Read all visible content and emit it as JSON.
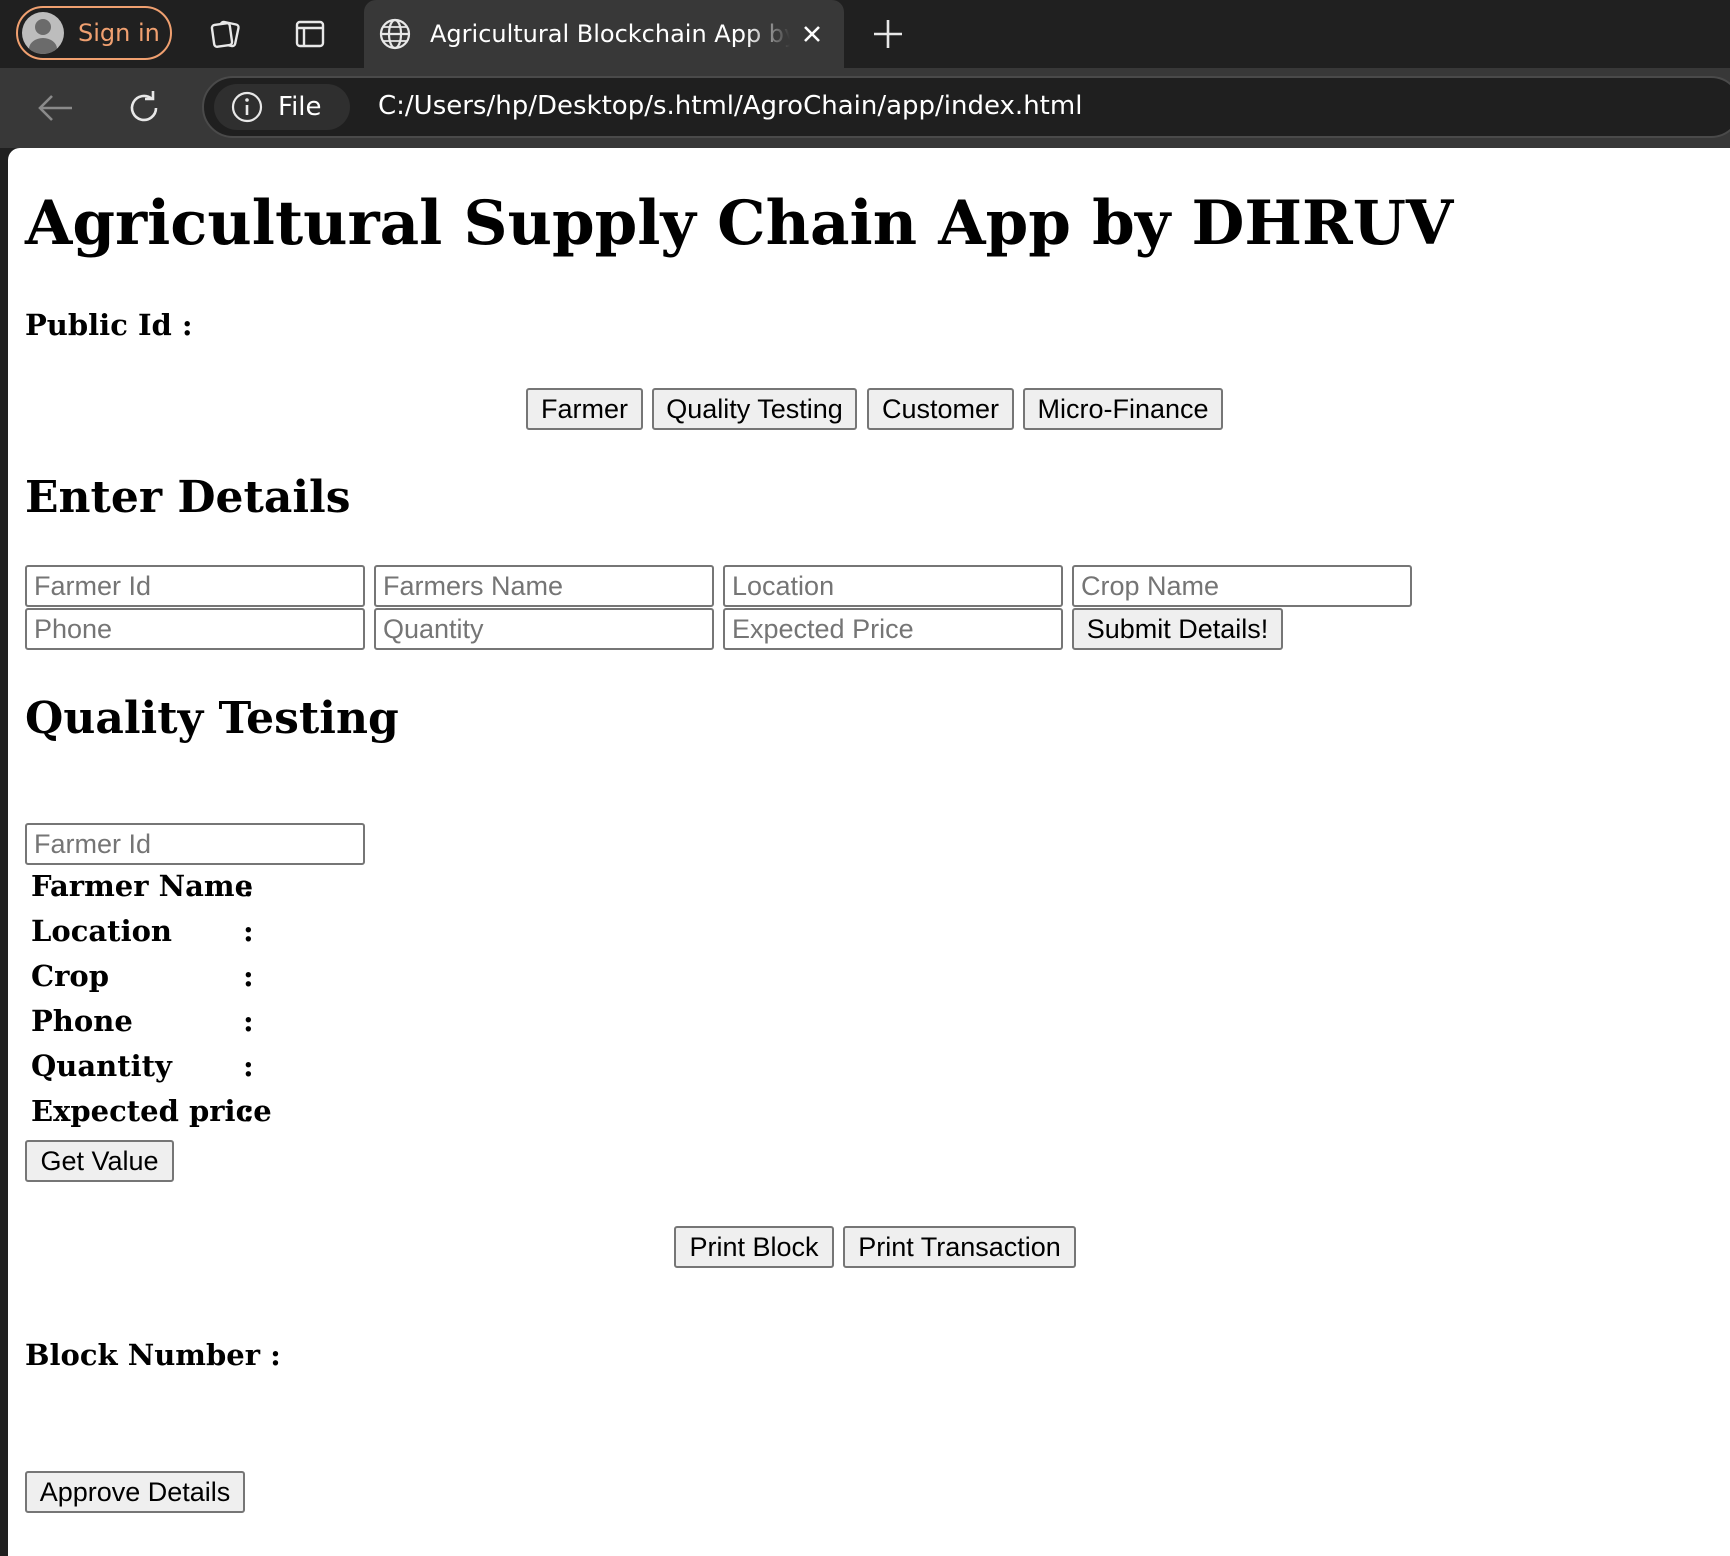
{
  "browser": {
    "signin_label": "Sign in",
    "tab_title": "Agricultural Blockchain App by dhruv",
    "site_chip_label": "File",
    "url": "C:/Users/hp/Desktop/s.html/AgroChain/app/index.html"
  },
  "page": {
    "title": "Agricultural Supply Chain App by DHRUV",
    "public_id_label": "Public Id :",
    "roles": [
      "Farmer",
      "Quality Testing",
      "Customer",
      "Micro-Finance"
    ],
    "enter_details": {
      "heading": "Enter Details",
      "fields": {
        "farmer_id": "Farmer Id",
        "farmers_name": "Farmers Name",
        "location": "Location",
        "crop_name": "Crop Name",
        "phone": "Phone",
        "quantity": "Quantity",
        "expected_price": "Expected Price"
      },
      "submit_label": "Submit Details!"
    },
    "quality_testing": {
      "heading": "Quality Testing",
      "farmer_id_placeholder": "Farmer Id",
      "info": [
        {
          "label": "Farmer Name",
          "sep": ":"
        },
        {
          "label": "Location",
          "sep": ":"
        },
        {
          "label": "Crop",
          "sep": ":"
        },
        {
          "label": "Phone",
          "sep": ":"
        },
        {
          "label": "Quantity",
          "sep": ":"
        },
        {
          "label": "Expected price",
          "sep": ":"
        }
      ],
      "get_value_label": "Get Value"
    },
    "print_block_label": "Print Block",
    "print_transaction_label": "Print Transaction",
    "block_number_label": "Block Number :",
    "approve_label": "Approve Details"
  }
}
